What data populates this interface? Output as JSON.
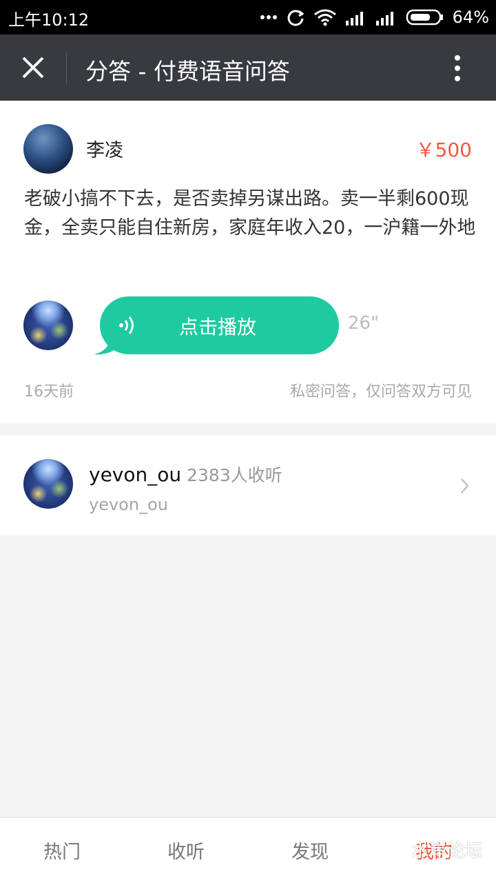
{
  "status_bar": {
    "time": "上午10:12",
    "battery_percent": "64%",
    "icons": [
      "more-dots-icon",
      "sync-icon",
      "wifi-icon",
      "signal-icon",
      "signal-icon",
      "battery-icon"
    ]
  },
  "title_bar": {
    "title": "分答 - 付费语音问答",
    "close_icon": "close-icon",
    "more_icon": "more-vertical-icon"
  },
  "question": {
    "asker_name": "李凌",
    "price": "￥500",
    "text": "老破小搞不下去，是否卖掉另谋出路。卖一半剩600现金，全卖只能自住新房，家庭年收入20，一沪籍一外地",
    "play_label": "点击播放",
    "duration": "26\"",
    "time_ago": "16天前",
    "privacy_note": "私密问答，仅问答双方可见"
  },
  "answerer": {
    "name": "yevon_ou",
    "listen_count": "2383人收听",
    "subtitle": "yevon_ou"
  },
  "bottom_nav": {
    "tabs": [
      {
        "label": "热门",
        "active": false
      },
      {
        "label": "收听",
        "active": false
      },
      {
        "label": "发现",
        "active": false
      },
      {
        "label": "我的",
        "active": true
      }
    ]
  },
  "watermark": {
    "text": "水岸论坛"
  },
  "colors": {
    "accent": "#f05a3c",
    "play_green": "#1ecba0",
    "title_bar": "#383a3f"
  }
}
